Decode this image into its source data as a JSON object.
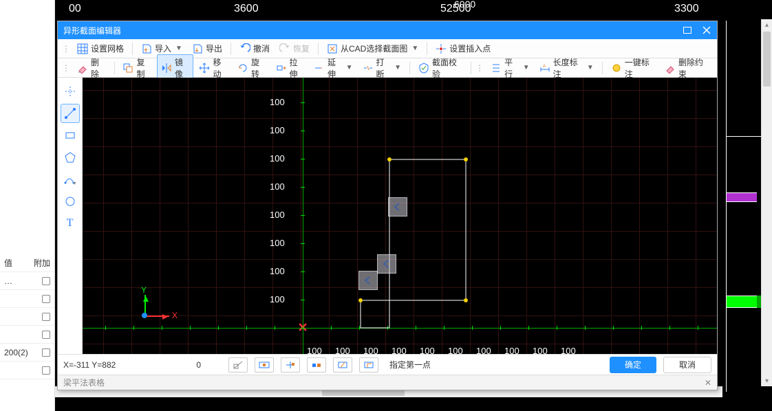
{
  "bg_ruler": {
    "d0": "00",
    "d1": "3600",
    "d2": "6000",
    "d2b": "52500",
    "d3": "3300"
  },
  "bg_left": {
    "h1": "值",
    "h2": "附加",
    "r1": "…",
    "r2": "200(2)"
  },
  "dialog": {
    "title": "异形截面编辑器",
    "tb1": {
      "grid": "设置网格",
      "import": "导入",
      "export": "导出",
      "undo": "撤消",
      "redo": "恢复",
      "from_cad": "从CAD选择截面图",
      "set_insert": "设置插入点"
    },
    "tb2": {
      "delete": "删除",
      "copy": "复制",
      "mirror": "镜像",
      "move": "移动",
      "rotate": "旋转",
      "stretch": "拉伸",
      "extend": "延伸",
      "break": "打断",
      "check": "截面校验",
      "parallel": "平行",
      "dim": "长度标注",
      "oneclick": "一键标注",
      "delcon": "删除约束"
    },
    "grid_labels": {
      "v": "100"
    },
    "x_labels": [
      "100",
      "100",
      "100",
      "100",
      "100",
      "100",
      "100",
      "100",
      "100",
      "100"
    ],
    "gizmo": {
      "x": "X",
      "y": "Y"
    },
    "status": {
      "coords": "X=-311 Y=882",
      "zero": "0",
      "hint": "指定第一点",
      "ok": "确定",
      "cancel": "取消"
    },
    "panel": "梁平法表格"
  }
}
